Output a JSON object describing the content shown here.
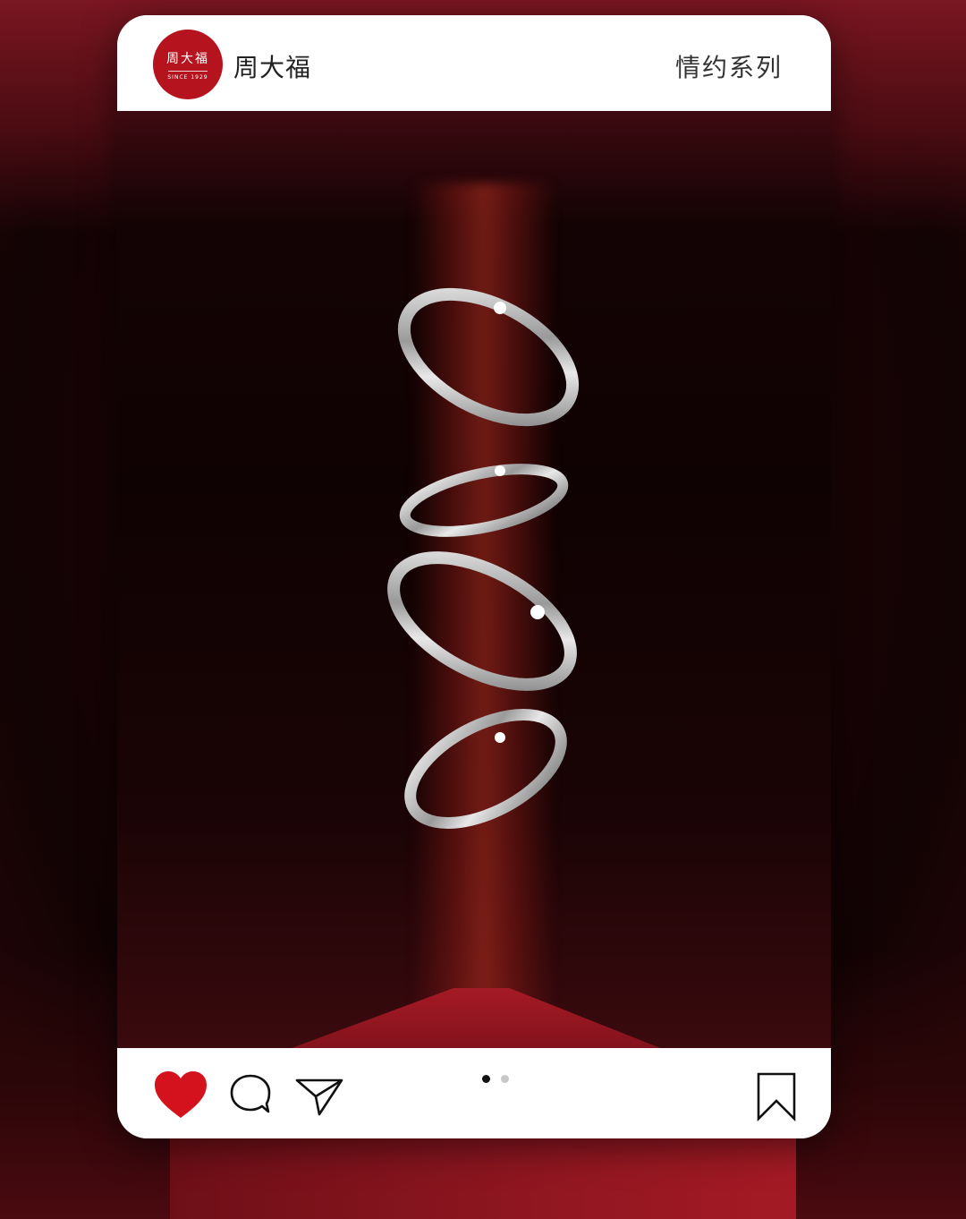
{
  "header": {
    "logo_text": "周大福",
    "logo_subtext": "SINCE 1929",
    "brand_name": "周大福",
    "collection_name": "情约系列"
  },
  "footer": {
    "icons": [
      "heart-icon",
      "comment-icon",
      "share-icon",
      "bookmark-icon"
    ],
    "carousel_total": 2,
    "carousel_active": 1
  },
  "colors": {
    "brand_red": "#b5141f",
    "heart_red": "#d4121d",
    "background_dark": "#140304"
  }
}
